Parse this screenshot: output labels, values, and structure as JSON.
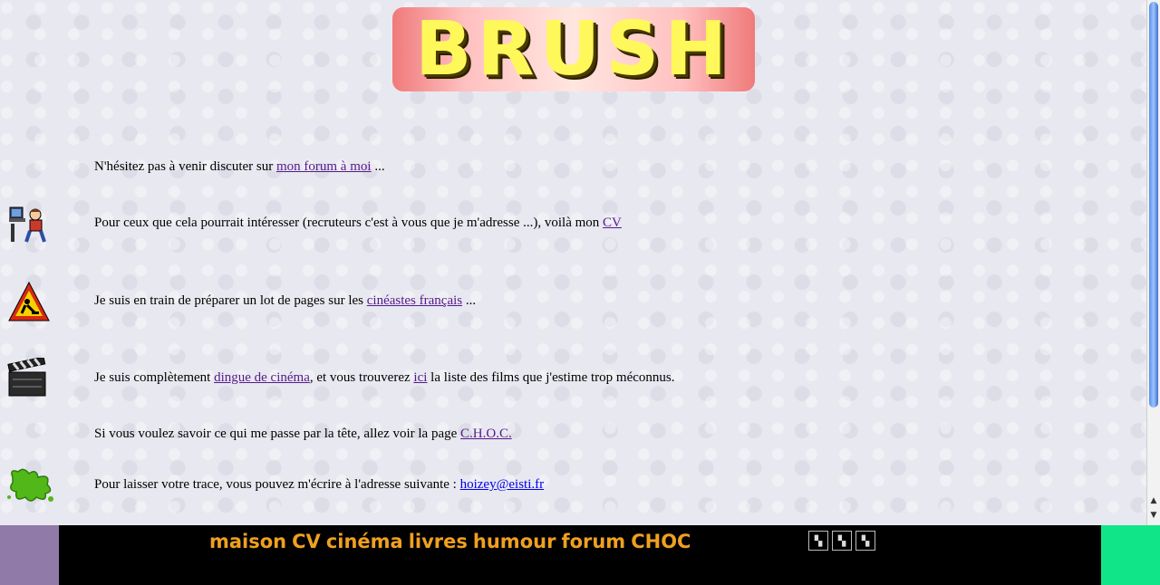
{
  "header": {
    "logo_text": "BRUSH"
  },
  "rows": [
    {
      "before": "N'hésitez pas à venir discuter sur ",
      "link": "mon forum à moi",
      "after": " ..."
    },
    {
      "before": "Pour ceux que cela pourrait intéresser (recruteurs c'est à vous que je m'adresse ...), voilà mon ",
      "link": "CV",
      "after": ""
    },
    {
      "before": "Je suis en train de préparer un lot de pages sur les ",
      "link": "cinéastes français",
      "after": " ..."
    },
    {
      "before": "Je suis complètement ",
      "link": "dingue de cinéma",
      "middle": ", et vous trouverez ",
      "link2": "ici",
      "after": " la liste des films que j'estime trop méconnus."
    },
    {
      "before": "Si vous voulez savoir ce qui me passe par la tête, allez voir la page ",
      "link": "C.H.O.C.",
      "after": ""
    },
    {
      "before": "Pour laisser votre trace, vous pouvez m'écrire à l'adresse suivante : ",
      "link": "hoizey@eisti.fr",
      "after": ""
    }
  ],
  "icons": {
    "row2": "person-at-computer-icon",
    "row3": "roadwork-sign-icon",
    "row4": "clapperboard-icon",
    "row6": "green-splat-icon"
  },
  "footer_nav": {
    "items": [
      "maison",
      "CV",
      "cinéma",
      "livres",
      "humour",
      "forum",
      "CHOC"
    ]
  },
  "colors": {
    "link_visited": "#551a8b",
    "link_unvisited": "#0000ee",
    "nav_text": "#f0a020",
    "footer_left": "#907aa8",
    "footer_right": "#10e688"
  }
}
